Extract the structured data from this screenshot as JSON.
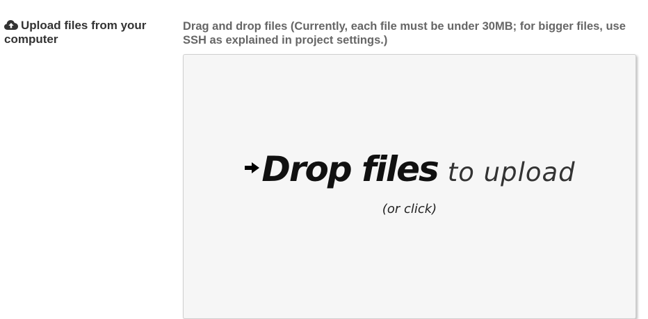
{
  "upload_section": {
    "title": "Upload files from your computer",
    "icon": "cloud-upload-icon"
  },
  "instructions": "Drag and drop files (Currently, each file must be under 30MB; for bigger files, use SSH as explained in project settings.)",
  "dropzone": {
    "icon": "arrow-right-icon",
    "headline_strong": "Drop files",
    "headline_light": "to upload",
    "subtext": "(or click)"
  },
  "colors": {
    "label_text": "#333333",
    "instructions_text": "#666666",
    "dropzone_bg": "#f6f6f6",
    "dropzone_border": "#cfcfcf"
  }
}
